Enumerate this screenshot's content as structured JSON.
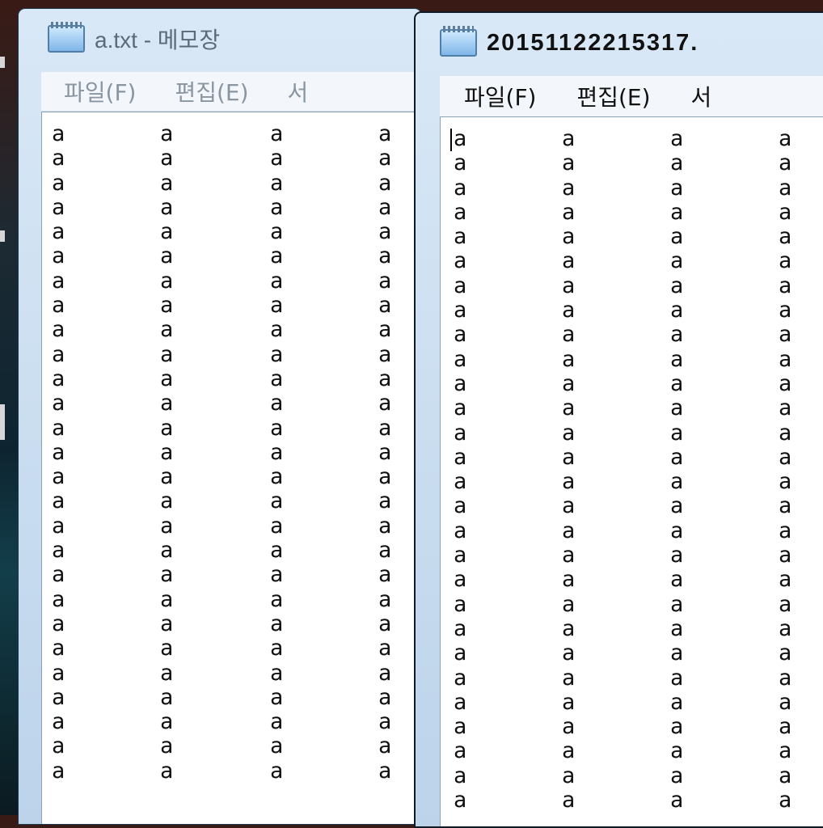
{
  "left_window": {
    "title": "a.txt - 메모장",
    "menu": [
      "파일(F)",
      "편집(E)",
      "서"
    ],
    "text_lines": [
      [
        "a",
        "a",
        "a",
        "a"
      ],
      [
        "a",
        "a",
        "a",
        "a"
      ],
      [
        "a",
        "a",
        "a",
        "a"
      ],
      [
        "a",
        "a",
        "a",
        "a"
      ],
      [
        "a",
        "a",
        "a",
        "a"
      ],
      [
        "a",
        "a",
        "a",
        "a"
      ],
      [
        "a",
        "a",
        "a",
        "a"
      ],
      [
        "a",
        "a",
        "a",
        "a"
      ],
      [
        "a",
        "a",
        "a",
        "a"
      ],
      [
        "a",
        "a",
        "a",
        "a"
      ],
      [
        "a",
        "a",
        "a",
        "a"
      ],
      [
        "a",
        "a",
        "a",
        "a"
      ],
      [
        "a",
        "a",
        "a",
        "a"
      ],
      [
        "a",
        "a",
        "a",
        "a"
      ],
      [
        "a",
        "a",
        "a",
        "a"
      ],
      [
        "a",
        "a",
        "a",
        "a"
      ],
      [
        "a",
        "a",
        "a",
        "a"
      ],
      [
        "a",
        "a",
        "a",
        "a"
      ],
      [
        "a",
        "a",
        "a",
        "a"
      ],
      [
        "a",
        "a",
        "a",
        "a"
      ],
      [
        "a",
        "a",
        "a",
        "a"
      ],
      [
        "a",
        "a",
        "a",
        "a"
      ],
      [
        "a",
        "a",
        "a",
        "a"
      ],
      [
        "a",
        "a",
        "a",
        "a"
      ],
      [
        "a",
        "a",
        "a",
        "a"
      ],
      [
        "a",
        "a",
        "a",
        "a"
      ],
      [
        "a",
        "a",
        "a",
        "a"
      ]
    ]
  },
  "right_window": {
    "title": "20151122215317.",
    "menu": [
      "파일(F)",
      "편집(E)",
      "서"
    ],
    "text_lines": [
      [
        "a",
        "a",
        "a",
        "a"
      ],
      [
        "a",
        "a",
        "a",
        "a"
      ],
      [
        "a",
        "a",
        "a",
        "a"
      ],
      [
        "a",
        "a",
        "a",
        "a"
      ],
      [
        "a",
        "a",
        "a",
        "a"
      ],
      [
        "a",
        "a",
        "a",
        "a"
      ],
      [
        "a",
        "a",
        "a",
        "a"
      ],
      [
        "a",
        "a",
        "a",
        "a"
      ],
      [
        "a",
        "a",
        "a",
        "a"
      ],
      [
        "a",
        "a",
        "a",
        "a"
      ],
      [
        "a",
        "a",
        "a",
        "a"
      ],
      [
        "a",
        "a",
        "a",
        "a"
      ],
      [
        "a",
        "a",
        "a",
        "a"
      ],
      [
        "a",
        "a",
        "a",
        "a"
      ],
      [
        "a",
        "a",
        "a",
        "a"
      ],
      [
        "a",
        "a",
        "a",
        "a"
      ],
      [
        "a",
        "a",
        "a",
        "a"
      ],
      [
        "a",
        "a",
        "a",
        "a"
      ],
      [
        "a",
        "a",
        "a",
        "a"
      ],
      [
        "a",
        "a",
        "a",
        "a"
      ],
      [
        "a",
        "a",
        "a",
        "a"
      ],
      [
        "a",
        "a",
        "a",
        "a"
      ],
      [
        "a",
        "a",
        "a",
        "a"
      ],
      [
        "a",
        "a",
        "a",
        "a"
      ],
      [
        "a",
        "a",
        "a",
        "a"
      ],
      [
        "a",
        "a",
        "a",
        "a"
      ],
      [
        "a",
        "a",
        "a",
        "a"
      ],
      [
        "a",
        "a",
        "a",
        "a"
      ]
    ]
  },
  "icons": {
    "left_app_icon": "notepad-icon",
    "right_app_icon": "notepad-icon"
  }
}
